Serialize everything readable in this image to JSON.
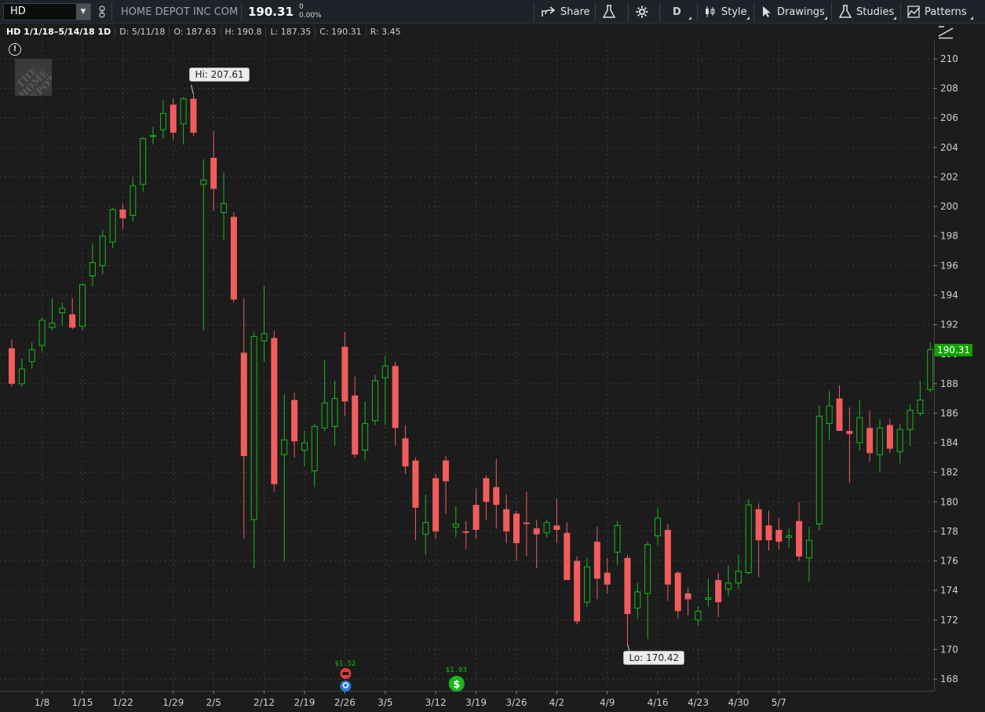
{
  "toolbar": {
    "symbol": "HD",
    "company": "HOME DEPOT INC COM",
    "last": "190.31",
    "change": "0",
    "change_pct": "0.00%",
    "share": "Share",
    "aggregation": "D",
    "style": "Style",
    "drawings": "Drawings",
    "studies": "Studies",
    "patterns": "Patterns"
  },
  "info": {
    "title": "HD 1/1/18–5/14/18 1D",
    "date": "D: 5/11/18",
    "open": "O: 187.63",
    "high": "H: 190.8",
    "low": "L: 187.35",
    "close": "C: 190.31",
    "range": "R: 3.45"
  },
  "annotations": {
    "hi": "Hi: 207.61",
    "lo": "Lo: 170.42",
    "price_tag": "190.31",
    "dividend_1": "$1.52",
    "dividend_2": "$1.03"
  },
  "logo_text": "THE HOME DEPOT",
  "colors": {
    "up": "#19b91a",
    "down": "#f25c5c",
    "background": "#1c1c1c",
    "last_price": "#0fa300"
  },
  "chart_data": {
    "type": "candlestick",
    "y_ticks": [
      168,
      170,
      172,
      174,
      176,
      178,
      180,
      182,
      184,
      186,
      188,
      190,
      192,
      194,
      196,
      198,
      200,
      202,
      204,
      206,
      208,
      210
    ],
    "x_tick_labels": [
      "1/8",
      "1/15",
      "1/22",
      "1/29",
      "2/5",
      "2/12",
      "2/19",
      "2/26",
      "3/5",
      "3/12",
      "3/19",
      "3/26",
      "4/2",
      "4/9",
      "4/16",
      "4/23",
      "4/30",
      "5/7"
    ],
    "x_tick_bars": [
      3,
      7,
      11,
      16,
      20,
      25,
      29,
      33,
      37,
      42,
      46,
      50,
      54,
      59,
      64,
      68,
      72,
      76
    ],
    "candles": [
      [
        190.4,
        191.0,
        187.8,
        188.0
      ],
      [
        188.0,
        189.7,
        187.8,
        189.0
      ],
      [
        189.5,
        190.8,
        189.0,
        190.3
      ],
      [
        190.6,
        192.5,
        190.2,
        192.3
      ],
      [
        191.8,
        193.8,
        191.6,
        192.1
      ],
      [
        192.8,
        193.5,
        191.9,
        193.1
      ],
      [
        192.7,
        193.8,
        191.7,
        191.8
      ],
      [
        191.9,
        194.8,
        191.6,
        194.7
      ],
      [
        195.3,
        197.5,
        194.6,
        196.2
      ],
      [
        196.0,
        198.4,
        195.4,
        198.0
      ],
      [
        197.6,
        199.9,
        197.2,
        199.8
      ],
      [
        199.8,
        200.2,
        198.5,
        199.2
      ],
      [
        199.4,
        202.0,
        199.0,
        201.4
      ],
      [
        201.5,
        204.7,
        201.0,
        204.6
      ],
      [
        204.8,
        205.4,
        204.2,
        204.8
      ],
      [
        205.2,
        207.2,
        204.6,
        206.3
      ],
      [
        206.9,
        207.3,
        204.5,
        205.0
      ],
      [
        205.6,
        207.4,
        204.2,
        207.3
      ],
      [
        207.3,
        207.6,
        204.8,
        205.0
      ],
      [
        201.5,
        203.2,
        191.6,
        201.8
      ],
      [
        203.3,
        205.1,
        199.7,
        201.2
      ],
      [
        199.6,
        202.3,
        197.7,
        200.2
      ],
      [
        199.3,
        199.6,
        193.5,
        193.7
      ],
      [
        190.1,
        193.8,
        177.5,
        183.1
      ],
      [
        178.8,
        191.5,
        175.5,
        191.2
      ],
      [
        190.9,
        194.6,
        189.5,
        191.4
      ],
      [
        191.1,
        191.6,
        180.7,
        181.2
      ],
      [
        183.2,
        187.3,
        176.0,
        184.2
      ],
      [
        186.9,
        187.4,
        183.0,
        184.1
      ],
      [
        183.5,
        184.8,
        182.4,
        184.0
      ],
      [
        182.1,
        185.3,
        181.0,
        185.1
      ],
      [
        185.0,
        189.6,
        184.8,
        186.7
      ],
      [
        185.1,
        188.2,
        183.8,
        187.0
      ],
      [
        190.5,
        191.5,
        185.8,
        186.8
      ],
      [
        187.2,
        188.5,
        183.0,
        183.2
      ],
      [
        183.5,
        186.8,
        182.8,
        185.3
      ],
      [
        185.5,
        188.6,
        185.2,
        188.2
      ],
      [
        188.4,
        189.9,
        185.2,
        189.2
      ],
      [
        189.2,
        189.5,
        183.8,
        185.0
      ],
      [
        184.3,
        185.2,
        181.9,
        182.4
      ],
      [
        182.8,
        183.0,
        177.4,
        179.6
      ],
      [
        177.8,
        180.5,
        176.4,
        178.6
      ],
      [
        181.6,
        181.9,
        177.5,
        178.0
      ],
      [
        182.8,
        183.1,
        179.2,
        181.4
      ],
      [
        178.3,
        179.7,
        177.6,
        178.5
      ],
      [
        178.0,
        178.7,
        176.8,
        177.9
      ],
      [
        179.8,
        180.9,
        177.5,
        178.1
      ],
      [
        181.6,
        181.8,
        178.8,
        180.0
      ],
      [
        181.0,
        182.9,
        178.2,
        179.8
      ],
      [
        179.5,
        180.5,
        177.2,
        178.0
      ],
      [
        179.2,
        179.4,
        176.0,
        177.2
      ],
      [
        178.6,
        180.7,
        176.3,
        178.5
      ],
      [
        178.2,
        178.8,
        175.5,
        177.8
      ],
      [
        177.9,
        178.8,
        177.6,
        178.6
      ],
      [
        178.4,
        180.2,
        177.2,
        178.1
      ],
      [
        177.9,
        178.6,
        175.1,
        174.7
      ],
      [
        176.0,
        176.3,
        171.7,
        171.9
      ],
      [
        173.2,
        176.2,
        172.9,
        175.6
      ],
      [
        177.3,
        178.3,
        173.4,
        174.8
      ],
      [
        175.2,
        176.2,
        173.8,
        174.4
      ],
      [
        176.6,
        178.7,
        175.7,
        178.4
      ],
      [
        176.2,
        176.4,
        170.4,
        172.4
      ],
      [
        172.8,
        174.5,
        172.1,
        173.9
      ],
      [
        173.8,
        177.3,
        170.7,
        177.1
      ],
      [
        177.7,
        179.6,
        177.1,
        178.9
      ],
      [
        178.1,
        178.5,
        173.3,
        174.4
      ],
      [
        175.2,
        175.3,
        172.1,
        172.6
      ],
      [
        173.8,
        174.2,
        172.3,
        173.4
      ],
      [
        172.0,
        172.9,
        171.6,
        172.6
      ],
      [
        173.4,
        174.8,
        172.9,
        173.5
      ],
      [
        174.7,
        175.2,
        172.2,
        173.2
      ],
      [
        174.1,
        175.7,
        173.6,
        174.5
      ],
      [
        174.5,
        176.4,
        174.1,
        175.3
      ],
      [
        175.2,
        180.2,
        175.1,
        179.8
      ],
      [
        179.5,
        179.9,
        174.9,
        177.4
      ],
      [
        178.4,
        179.4,
        176.7,
        177.4
      ],
      [
        178.1,
        178.9,
        176.8,
        177.3
      ],
      [
        177.6,
        178.2,
        176.9,
        177.7
      ],
      [
        178.7,
        180.0,
        176.0,
        176.3
      ],
      [
        176.2,
        178.3,
        174.6,
        177.4
      ],
      [
        178.5,
        186.5,
        178.1,
        185.8
      ],
      [
        185.3,
        187.5,
        184.2,
        186.5
      ],
      [
        187.0,
        187.9,
        185.0,
        184.8
      ],
      [
        184.8,
        186.4,
        181.3,
        184.6
      ],
      [
        184.0,
        186.9,
        183.5,
        185.7
      ],
      [
        185.0,
        186.2,
        182.7,
        183.3
      ],
      [
        183.2,
        185.6,
        182.0,
        185.0
      ],
      [
        185.2,
        185.6,
        183.3,
        183.6
      ],
      [
        183.4,
        185.3,
        182.6,
        184.9
      ],
      [
        184.9,
        186.6,
        183.8,
        186.2
      ],
      [
        186.0,
        188.2,
        185.8,
        186.9
      ],
      [
        187.6,
        190.8,
        187.4,
        190.3
      ]
    ]
  }
}
